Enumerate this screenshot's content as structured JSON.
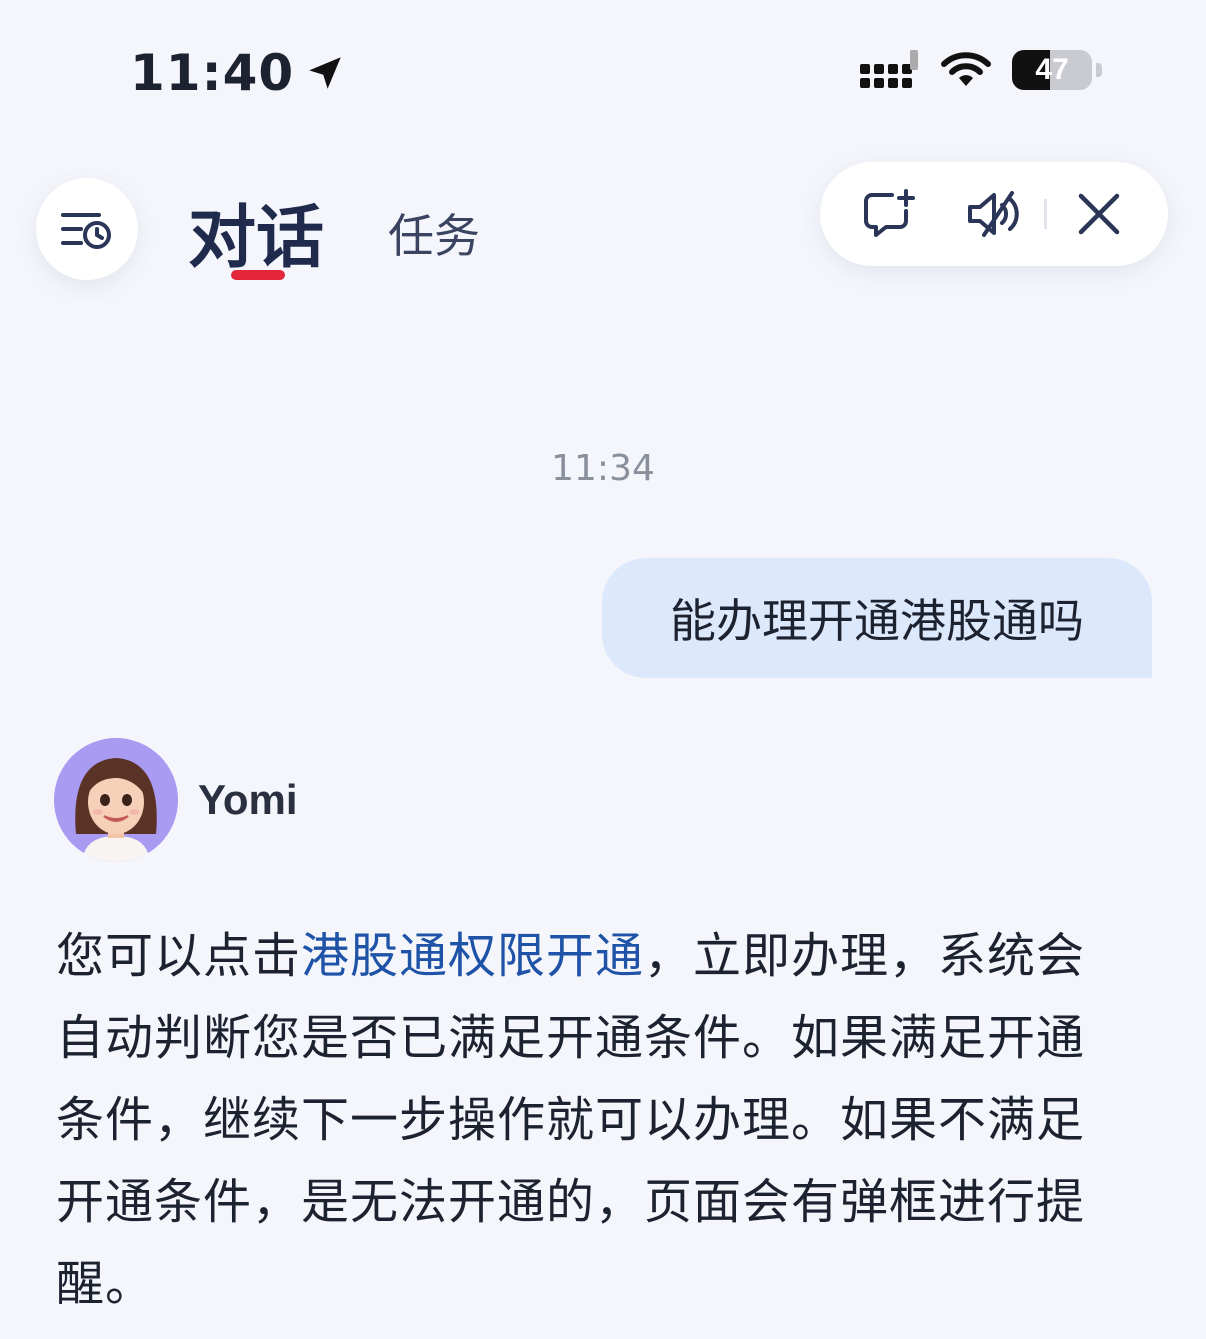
{
  "status_bar": {
    "time": "11:40",
    "battery": "47",
    "battery_level": 0.47,
    "icons": [
      "location-arrow-icon",
      "cellular-signal-icon",
      "wifi-icon",
      "battery-icon"
    ]
  },
  "header": {
    "tabs": [
      {
        "label": "对话",
        "active": true
      },
      {
        "label": "任务",
        "active": false
      }
    ],
    "accent_color": "#e4263b",
    "buttons": [
      "history-icon",
      "new-chat-icon",
      "mute-icon",
      "close-icon"
    ]
  },
  "conversation": {
    "timestamp": "11:34",
    "user_message": "能办理开通港股通吗",
    "bot": {
      "name": "Yomi",
      "reply_before": "您可以点击",
      "reply_link": "港股通权限开通",
      "reply_after": "，立即办理，系统会自动判断您是否已满足开通条件。如果满足开通条件，继续下一步操作就可以办理。如果不满足开通条件，是无法开通的，页面会有弹框进行提醒。"
    }
  },
  "colors": {
    "background": "#f4f6fb",
    "user_bubble": "#dce8fb",
    "link": "#1f53a8"
  }
}
